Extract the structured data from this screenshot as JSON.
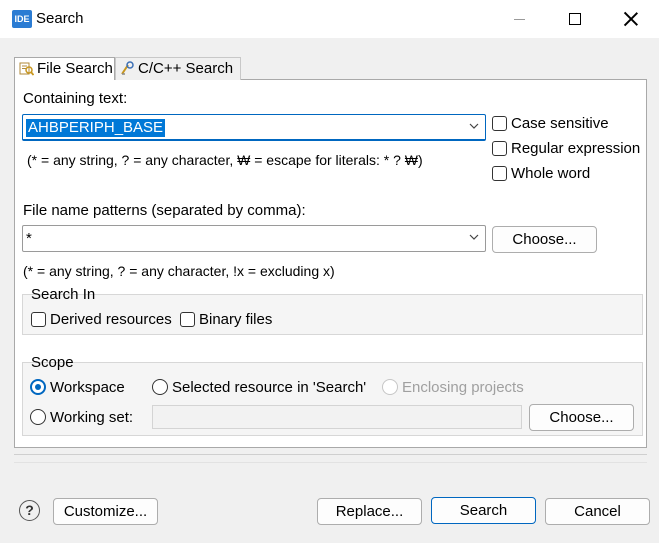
{
  "window": {
    "icon_text": "IDE",
    "title": "Search"
  },
  "tabs": [
    {
      "label": "File Search",
      "icon": "file-search-icon",
      "active": true
    },
    {
      "label": "C/C++ Search",
      "icon": "cpp-search-icon",
      "active": false
    }
  ],
  "containing_text": {
    "label": "Containing text:",
    "value": "AHBPERIPH_BASE",
    "hint": "(* = any string, ? = any character, ₩ = escape for literals: * ? ₩)"
  },
  "options": {
    "case_sensitive": "Case sensitive",
    "regular_expression": "Regular expression",
    "whole_word": "Whole word"
  },
  "file_patterns": {
    "label": "File name patterns (separated by comma):",
    "value": "*",
    "hint": "(* = any string, ? = any character, !x = excluding x)",
    "choose_label": "Choose..."
  },
  "search_in": {
    "title": "Search In",
    "derived": "Derived resources",
    "binary": "Binary files"
  },
  "scope": {
    "title": "Scope",
    "workspace": "Workspace",
    "selected_resource": "Selected resource in 'Search'",
    "enclosing_projects": "Enclosing projects",
    "working_set": "Working set:",
    "working_set_value": "",
    "choose_label": "Choose..."
  },
  "footer": {
    "help": "?",
    "customize": "Customize...",
    "replace": "Replace...",
    "search": "Search",
    "cancel": "Cancel"
  },
  "colors": {
    "accent": "#0067c0",
    "selection": "#0078d7"
  }
}
